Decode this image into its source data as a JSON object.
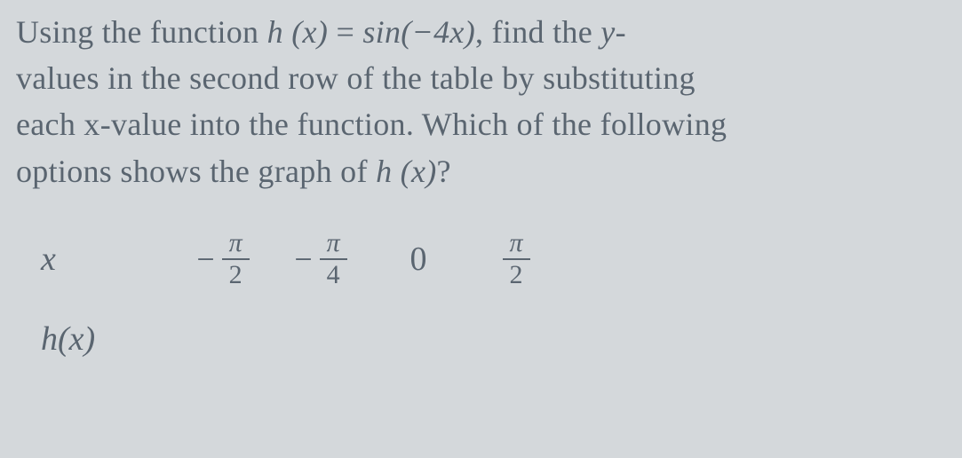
{
  "question": {
    "line1_part1": "Using the function ",
    "func_lhs": "h (x)",
    "equals": " = ",
    "func_rhs": "sin(−4x)",
    "line1_part2": ", find the ",
    "yvar": "y",
    "line1_part3": "-",
    "line2": "values in the second row of the table by substituting",
    "line3": "each x-value into the function. Which of the following",
    "line4_part1": "options shows the graph of ",
    "func_ref": "h (x)",
    "line4_part2": "?"
  },
  "table": {
    "x_label": "x",
    "hx_label": "h(x)",
    "cells": {
      "c0_sign": "−",
      "c0_num": "π",
      "c0_den": "2",
      "c1_sign": "−",
      "c1_num": "π",
      "c1_den": "4",
      "c2": "0",
      "c3_num": "π",
      "c3_den": "2"
    }
  },
  "chart_data": {
    "type": "table",
    "title": "Function values table for h(x) = sin(-4x)",
    "columns": [
      "x",
      "h(x)"
    ],
    "rows": [
      {
        "x": "-π/2",
        "hx": ""
      },
      {
        "x": "-π/4",
        "hx": ""
      },
      {
        "x": "0",
        "hx": ""
      },
      {
        "x": "π/2",
        "hx": ""
      }
    ]
  }
}
